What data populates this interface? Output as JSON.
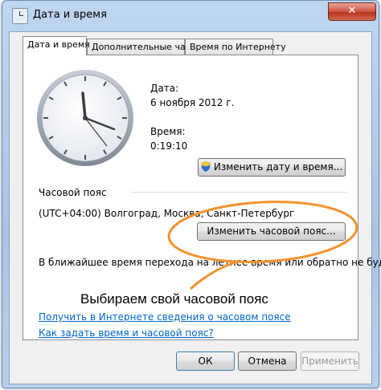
{
  "window": {
    "title": "Дата и время",
    "close_glyph": "✕"
  },
  "tabs": [
    {
      "label": "Дата и время",
      "active": true
    },
    {
      "label": "Дополнительные часы",
      "active": false
    },
    {
      "label": "Время по Интернету",
      "active": false
    }
  ],
  "datetime": {
    "date_label": "Дата:",
    "date_value": "6 ноября 2012 г.",
    "time_label": "Время:",
    "time_value": "0:19:10",
    "change_button": "Изменить дату и время..."
  },
  "timezone": {
    "group_label": "Часовой пояс",
    "value": "(UTC+04:00) Волгоград, Москва, Санкт-Петербург",
    "change_button": "Изменить часовой пояс...",
    "dst_note": "В ближайшее время перехода на летнее время или обратно не будет."
  },
  "annotation": {
    "caption": "Выбираем свой часовой пояс",
    "color": "#f5922e"
  },
  "links": [
    "Получить в Интернете сведения о часовом поясе",
    "Как задать время и часовой пояс?"
  ],
  "footer": {
    "ok": "ОК",
    "cancel": "Отмена",
    "apply": "Применить"
  },
  "icons": {
    "window": "clock-icon",
    "uac": "uac-shield-icon"
  }
}
